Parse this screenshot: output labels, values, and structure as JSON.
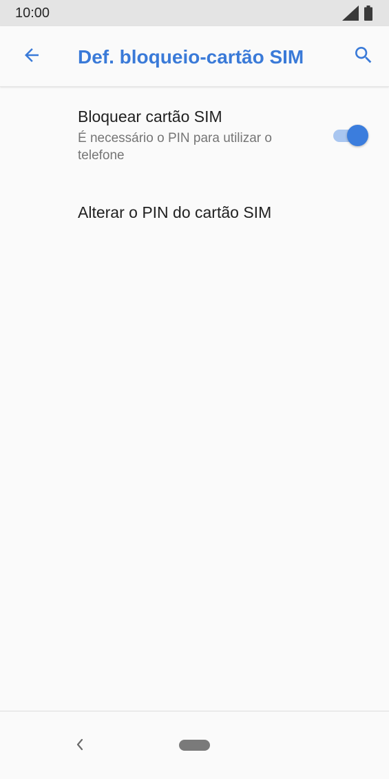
{
  "status_bar": {
    "time": "10:00",
    "icons": [
      "signal-icon",
      "battery-icon"
    ]
  },
  "app_bar": {
    "back_icon": "arrow-back-icon",
    "title": "Def. bloqueio-cartão SIM",
    "search_icon": "search-icon"
  },
  "preferences": {
    "sim_lock": {
      "title": "Bloquear cartão SIM",
      "summary": "É necessário o PIN para utilizar o telefone",
      "enabled": true
    },
    "change_pin": {
      "title": "Alterar o PIN do cartão SIM"
    }
  },
  "nav_bar": {
    "back_icon": "chevron-left-icon",
    "home_icon": "home-pill-icon"
  },
  "colors": {
    "accent": "#3a7ad8",
    "toggle_thumb": "#3b7ddd",
    "toggle_track": "#a9c6f0",
    "status_bar_bg": "#e4e4e4",
    "background": "#fafafa"
  }
}
